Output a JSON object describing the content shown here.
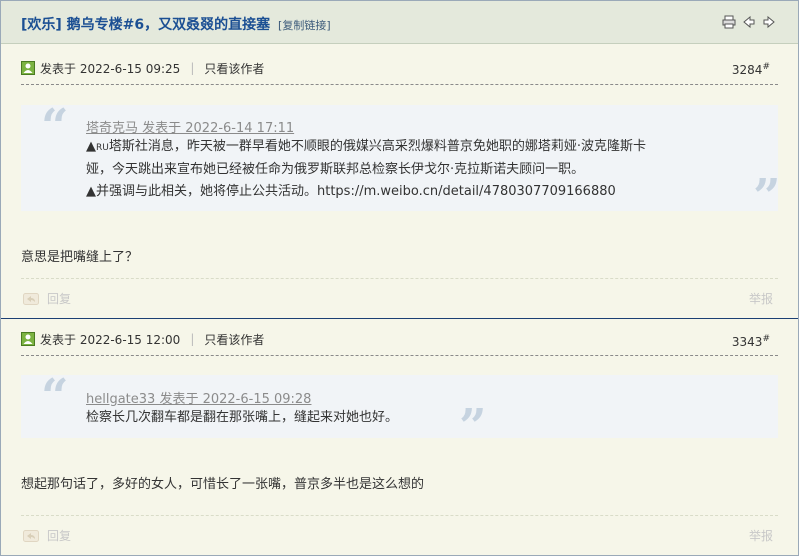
{
  "thread": {
    "title": "[欢乐] 鹅乌专楼#6，又双叒叕的直接塞",
    "copy_link": "[复制链接]"
  },
  "posts": [
    {
      "posted": "发表于 2022-6-15 09:25",
      "only_author": "只看该作者",
      "floor": "3284",
      "floor_mark": "#",
      "quote": {
        "author_line": "塔奇克马 发表于 2022-6-14 17:11",
        "line1_prefix": "▲",
        "line1_ru": "RU",
        "line1_rest": "塔斯社消息，昨天被一群早看她不顺眼的俄媒兴高采烈爆料普京免她职的娜塔莉娅·波克隆斯卡",
        "line2": "娅，今天跳出来宣布她已经被任命为俄罗斯联邦总检察长伊戈尔·克拉斯诺夫顾问一职。",
        "line3": "▲并强调与此相关，她将停止公共活动。https://m.weibo.cn/detail/4780307709166880"
      },
      "message": "意思是把嘴缝上了？",
      "reply_label": "回复",
      "report_label": "举报"
    },
    {
      "posted": "发表于 2022-6-15 12:00",
      "only_author": "只看该作者",
      "floor": "3343",
      "floor_mark": "#",
      "quote": {
        "author_line": "hellgate33 发表于 2022-6-15 09:28",
        "line1": "检察长几次翻车都是翻在那张嘴上，缝起来对她也好。"
      },
      "message": "想起那句话了，多好的女人，可惜长了一张嘴，普京多半也是这么想的",
      "reply_label": "回复",
      "report_label": "举报"
    }
  ],
  "icons": {
    "print": "printer-icon",
    "prev": "arrow-left-icon",
    "next": "arrow-right-icon",
    "online": "online-user-icon",
    "reply": "reply-icon"
  }
}
